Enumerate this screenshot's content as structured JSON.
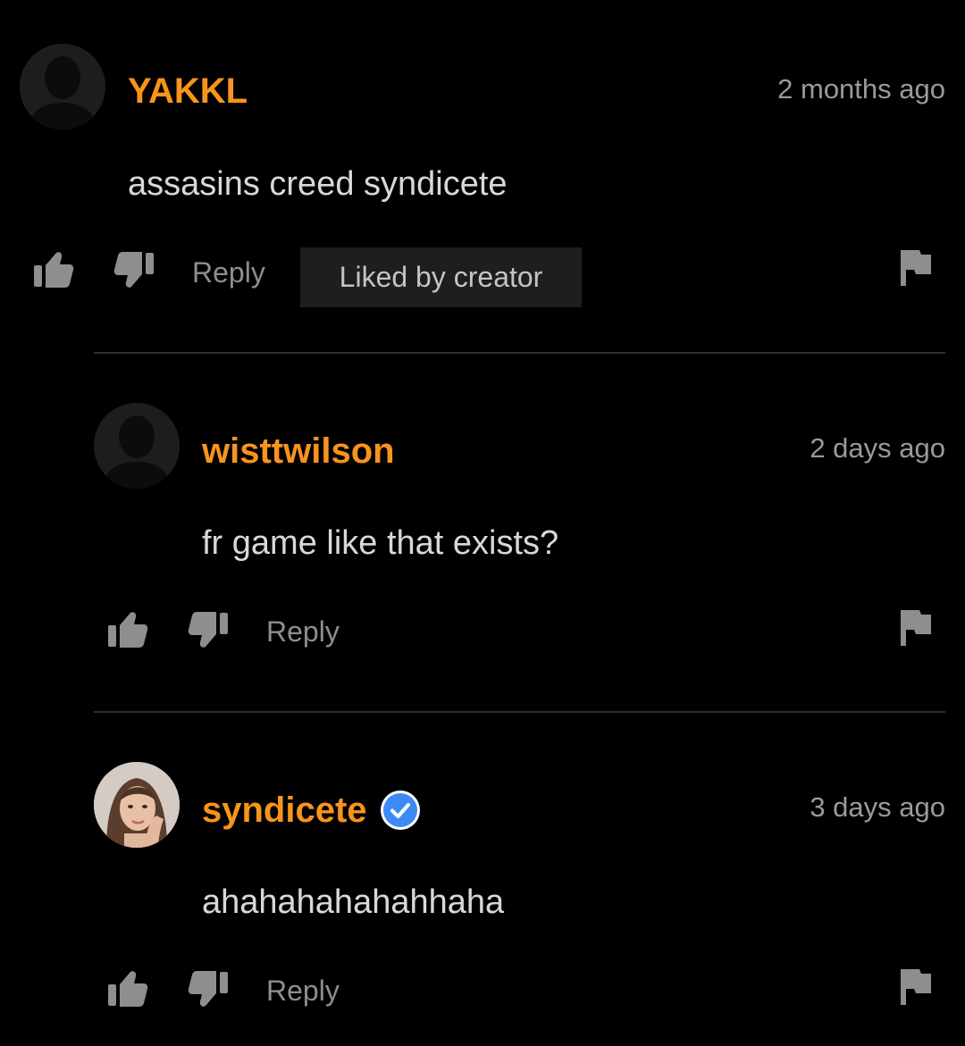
{
  "comments": [
    {
      "username": "YAKKL",
      "timestamp": "2 months ago",
      "text": "assasins creed syndicete",
      "reply_label": "Reply",
      "badge": "Liked by creator"
    },
    {
      "username": "wisttwilson",
      "timestamp": "2 days ago",
      "text": "fr game like that exists?",
      "reply_label": "Reply"
    },
    {
      "username": "syndicete",
      "timestamp": "3 days ago",
      "text": "ahahahahahahhaha",
      "reply_label": "Reply",
      "verified": true
    }
  ],
  "icons": {
    "like": "thumbs-up-icon",
    "dislike": "thumbs-down-icon",
    "report": "flag-icon",
    "verified": "verified-check-icon",
    "avatar_placeholder": "default-avatar-icon"
  },
  "colors": {
    "background": "#000000",
    "username": "#f7941d",
    "timestamp": "#9a9a9a",
    "text": "#d8d8d8",
    "action": "#8e8e8e",
    "badge_bg": "#1e1e1e",
    "verified": "#3d8af7"
  }
}
